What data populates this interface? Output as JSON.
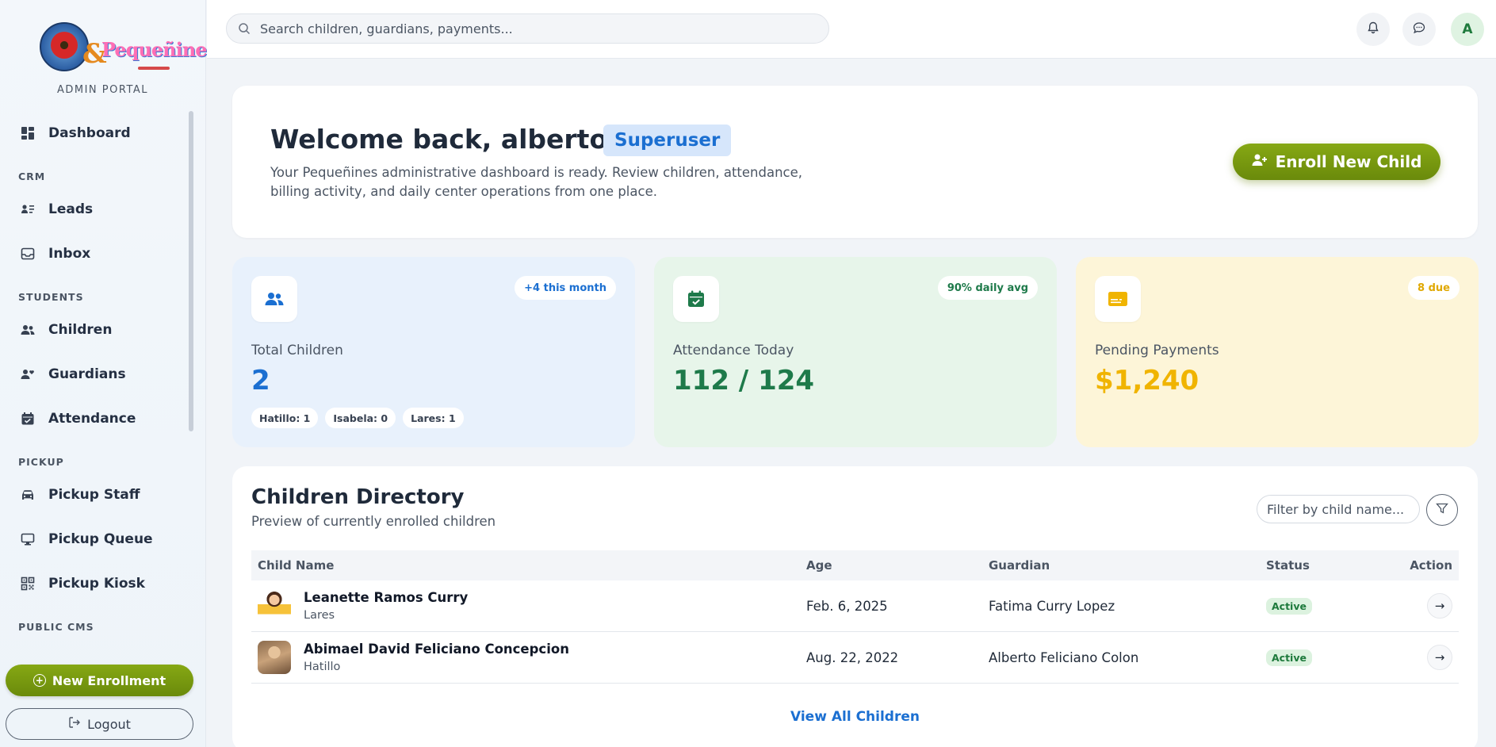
{
  "brand": {
    "logo_alt": "& Pequeñines",
    "portal_label": "ADMIN PORTAL"
  },
  "sidebar": {
    "items": [
      {
        "type": "item",
        "label": "Dashboard",
        "icon": "dashboard-icon"
      },
      {
        "type": "section",
        "label": "CRM"
      },
      {
        "type": "item",
        "label": "Leads",
        "icon": "contact-card-icon"
      },
      {
        "type": "item",
        "label": "Inbox",
        "icon": "inbox-icon"
      },
      {
        "type": "section",
        "label": "STUDENTS"
      },
      {
        "type": "item",
        "label": "Children",
        "icon": "users-icon"
      },
      {
        "type": "item",
        "label": "Guardians",
        "icon": "user-heart-icon"
      },
      {
        "type": "item",
        "label": "Attendance",
        "icon": "calendar-check-icon"
      },
      {
        "type": "section",
        "label": "PICKUP"
      },
      {
        "type": "item",
        "label": "Pickup Staff",
        "icon": "car-icon"
      },
      {
        "type": "item",
        "label": "Pickup Queue",
        "icon": "monitor-icon"
      },
      {
        "type": "item",
        "label": "Pickup Kiosk",
        "icon": "qr-code-icon"
      },
      {
        "type": "section",
        "label": "PUBLIC CMS"
      }
    ],
    "new_enrollment_label": "New Enrollment",
    "logout_label": "Logout"
  },
  "topbar": {
    "search_placeholder": "Search children, guardians, payments...",
    "avatar_initial": "A"
  },
  "welcome": {
    "greeting": "Welcome back, alberto!",
    "role": "Superuser",
    "description": "Your Pequeñines administrative dashboard is ready. Review children, attendance, billing activity, and daily center operations from one place.",
    "enroll_label": "Enroll New Child"
  },
  "stats": {
    "children": {
      "label": "Total Children",
      "value": "2",
      "pill": "+4 this month",
      "chips": [
        "Hatillo: 1",
        "Isabela: 0",
        "Lares: 1"
      ],
      "color": "#1b6fd1",
      "bg": "#e8f1fc"
    },
    "attendance": {
      "label": "Attendance Today",
      "value": "112 / 124",
      "pill": "90% daily avg",
      "color": "#1e7a4a",
      "bg": "#e7f5ea"
    },
    "payments": {
      "label": "Pending Payments",
      "value": "$1,240",
      "pill": "8 due",
      "color": "#f0b400",
      "bg": "#fdf5d8"
    }
  },
  "directory": {
    "title": "Children Directory",
    "subtitle": "Preview of currently enrolled children",
    "filter_placeholder": "Filter by child name...",
    "columns": {
      "name": "Child Name",
      "age": "Age",
      "guardian": "Guardian",
      "status": "Status",
      "action": "Action"
    },
    "rows": [
      {
        "name": "Leanette Ramos Curry",
        "location": "Lares",
        "age": "Feb. 6, 2025",
        "guardian": "Fatima Curry Lopez",
        "status": "Active"
      },
      {
        "name": "Abimael David Feliciano Concepcion",
        "location": "Hatillo",
        "age": "Aug. 22, 2022",
        "guardian": "Alberto Feliciano Colon",
        "status": "Active"
      }
    ],
    "view_all_label": "View All Children"
  }
}
